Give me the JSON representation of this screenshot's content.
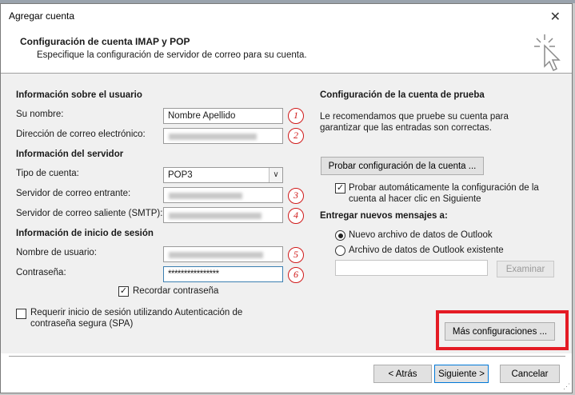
{
  "window": {
    "title": "Agregar cuenta"
  },
  "header": {
    "title": "Configuración de cuenta IMAP y POP",
    "subtitle": "Especifique la configuración de servidor de correo para su cuenta."
  },
  "user_info": {
    "heading": "Información sobre el usuario",
    "name_label": "Su nombre:",
    "name_value": "Nombre Apellido",
    "email_label": "Dirección de correo electrónico:",
    "email_value": " "
  },
  "server_info": {
    "heading": "Información del servidor",
    "type_label": "Tipo de cuenta:",
    "type_value": "POP3",
    "incoming_label": "Servidor de correo entrante:",
    "outgoing_label": "Servidor de correo saliente (SMTP):"
  },
  "login_info": {
    "heading": "Información de inicio de sesión",
    "user_label": "Nombre de usuario:",
    "password_label": "Contraseña:",
    "password_value": "****************",
    "remember_label": "Recordar contraseña"
  },
  "spa": {
    "label": "Requerir inicio de sesión utilizando Autenticación de contraseña segura (SPA)"
  },
  "markers": [
    "1",
    "2",
    "3",
    "4",
    "5",
    "6"
  ],
  "test": {
    "heading": "Configuración de la cuenta de prueba",
    "description": "Le recomendamos que pruebe su cuenta para garantizar que las entradas son correctas.",
    "button": "Probar configuración de la cuenta ...",
    "auto_label": "Probar automáticamente la configuración de la cuenta al hacer clic en Siguiente"
  },
  "deliver": {
    "heading": "Entregar nuevos mensajes a:",
    "option_new": "Nuevo archivo de datos de Outlook",
    "option_existing": "Archivo de datos de Outlook existente",
    "browse": "Examinar"
  },
  "more_button": "Más configuraciones ...",
  "footer": {
    "back": "< Atrás",
    "next": "Siguiente >",
    "cancel": "Cancelar"
  },
  "colors": {
    "highlight_box": "#e41b24",
    "marker": "#d01a1a",
    "primary_border": "#0078d7"
  }
}
